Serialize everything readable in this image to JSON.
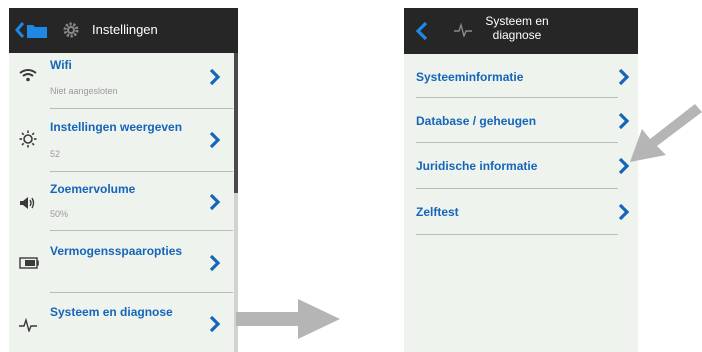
{
  "left_panel": {
    "title": "Instellingen",
    "icons": {
      "back": "chevron-left-icon",
      "folder": "folder-icon",
      "settings": "gear-icon"
    },
    "items": [
      {
        "label": "Wifi",
        "sub": "Niet aangesloten",
        "icon": "wifi-icon"
      },
      {
        "label": "Instellingen weergeven",
        "sub": "52",
        "icon": "brightness-icon"
      },
      {
        "label": "Zoemervolume",
        "sub": "50%",
        "icon": "speaker-icon"
      },
      {
        "label": "Vermogensspaaropties",
        "sub": "",
        "icon": "battery-icon"
      },
      {
        "label": "Systeem en diagnose",
        "sub": "",
        "icon": "pulse-icon"
      }
    ]
  },
  "right_panel": {
    "title": "Systeem en diagnose",
    "icons": {
      "back": "chevron-left-icon",
      "header": "pulse-icon"
    },
    "items": [
      {
        "label": "Systeeminformatie"
      },
      {
        "label": "Database / geheugen"
      },
      {
        "label": "Juridische informatie"
      },
      {
        "label": "Zelftest"
      }
    ]
  },
  "colors": {
    "accent": "#1565b8",
    "titlebar": "#262626",
    "panel_bg": "#eef3ee",
    "annotation_arrow": "#b5b5b5"
  }
}
